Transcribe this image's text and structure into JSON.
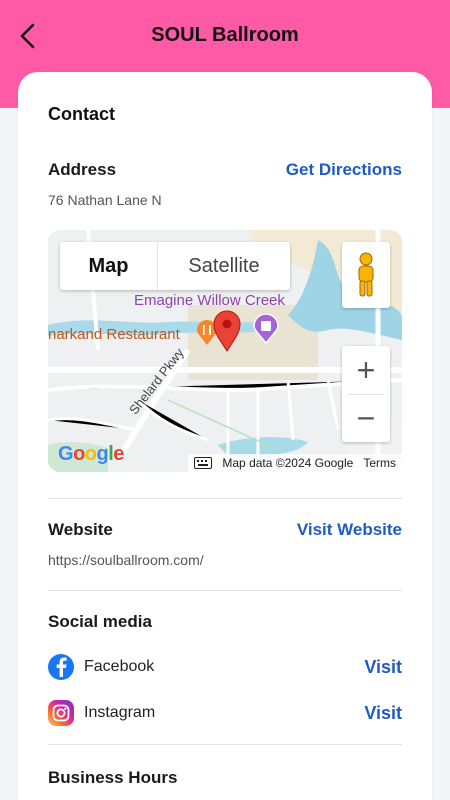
{
  "header": {
    "title": "SOUL Ballroom",
    "background": "#ff5aa5"
  },
  "contact": {
    "title": "Contact",
    "address": {
      "label": "Address",
      "value": "76 Nathan Lane N",
      "action": "Get Directions"
    },
    "map": {
      "toggle": {
        "map": "Map",
        "satellite": "Satellite"
      },
      "places": {
        "theater": "Emagine Willow Creek",
        "restaurant": "narkand Restaurant",
        "road": "Shelard Pkwy"
      },
      "logo": "Google",
      "attribution": "Map data ©2024 Google",
      "terms": "Terms",
      "zoom_in": "+",
      "zoom_out": "−"
    },
    "website": {
      "label": "Website",
      "value": "https://soulballroom.com/",
      "action": "Visit Website"
    },
    "social": {
      "label": "Social media",
      "items": [
        {
          "name": "Facebook",
          "action": "Visit",
          "icon": "facebook-icon",
          "color": "#1877f2"
        },
        {
          "name": "Instagram",
          "action": "Visit",
          "icon": "instagram-icon",
          "color": "#d6249f"
        }
      ]
    },
    "hours": {
      "label": "Business Hours"
    }
  },
  "colors": {
    "accent": "#ff5aa5",
    "link": "#1f5bc4"
  }
}
